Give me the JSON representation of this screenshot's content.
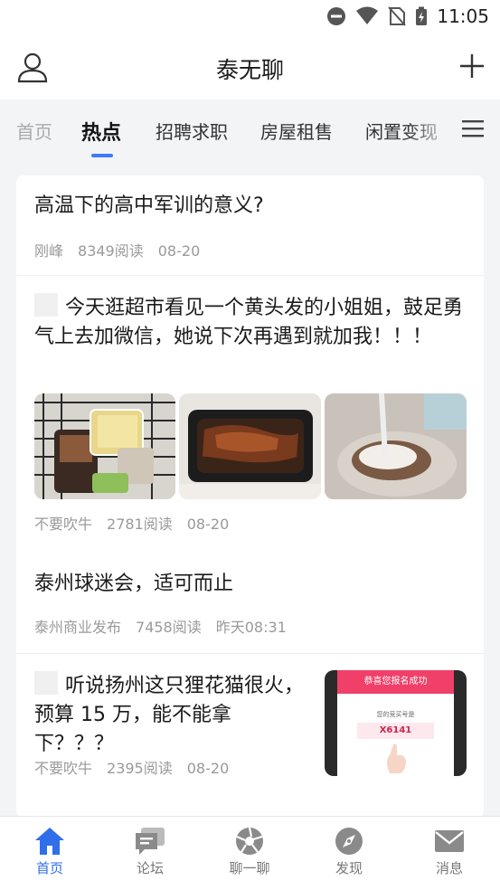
{
  "status": {
    "time": "11:05"
  },
  "header": {
    "title": "泰无聊"
  },
  "tabs": [
    {
      "label": "首页"
    },
    {
      "label": "热点"
    },
    {
      "label": "招聘求职"
    },
    {
      "label": "房屋租售"
    },
    {
      "label": "闲置变现"
    }
  ],
  "posts": [
    {
      "title": "高温下的高中军训的意义?",
      "author": "刚峰",
      "reads": "8349阅读",
      "date": "08-20"
    },
    {
      "title": "今天逛超市看见一个黄头发的小姐姐，鼓足勇气上去加微信，她说下次再遇到就加我！！！",
      "author": "不要吹牛",
      "reads": "2781阅读",
      "date": "08-20"
    },
    {
      "title": "泰州球迷会，适可而止",
      "author": "泰州商业发布",
      "reads": "7458阅读",
      "date": "昨天08:31"
    },
    {
      "title": "听说扬州这只狸花猫很火，预算 15 万，能不能拿下？？？",
      "author": "不要吹牛",
      "reads": "2395阅读",
      "date": "08-20",
      "thumb": {
        "banner": "恭喜您报名成功",
        "caption": "您的竞买号是",
        "code": "X6141"
      }
    }
  ],
  "bottom_nav": [
    {
      "label": "首页",
      "icon": "home-icon"
    },
    {
      "label": "论坛",
      "icon": "forum-icon"
    },
    {
      "label": "聊一聊",
      "icon": "aperture-icon"
    },
    {
      "label": "发现",
      "icon": "compass-icon"
    },
    {
      "label": "消息",
      "icon": "mail-icon"
    }
  ],
  "colors": {
    "accent": "#2f6fea",
    "indicator": "#3a7afe",
    "background": "#f3f4f6"
  }
}
